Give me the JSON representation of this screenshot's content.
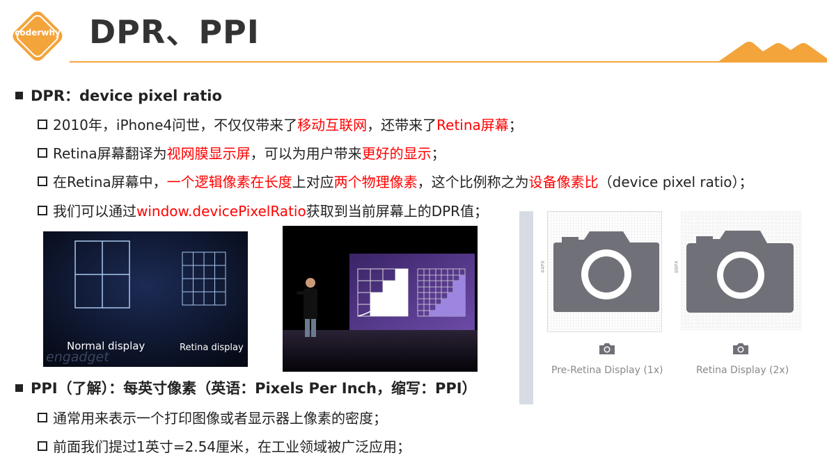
{
  "header": {
    "logo_text": "coderwhy",
    "title": "DPR、PPI"
  },
  "dpr": {
    "heading": "DPR：device pixel ratio",
    "items": [
      {
        "parts": [
          {
            "text": "2010年，iPhone4问世，不仅仅带来了",
            "red": false
          },
          {
            "text": "移动互联网",
            "red": true
          },
          {
            "text": "，还带来了",
            "red": false
          },
          {
            "text": "Retina屏幕",
            "red": true
          },
          {
            "text": "；",
            "red": false
          }
        ]
      },
      {
        "parts": [
          {
            "text": "Retina屏幕翻译为",
            "red": false
          },
          {
            "text": "视网膜显示屏",
            "red": true
          },
          {
            "text": "，可以为用户带来",
            "red": false
          },
          {
            "text": "更好的显示",
            "red": true
          },
          {
            "text": "；",
            "red": false
          }
        ]
      },
      {
        "parts": [
          {
            "text": "在Retina屏幕中，",
            "red": false
          },
          {
            "text": "一个逻辑像素在长度",
            "red": true
          },
          {
            "text": "上对应",
            "red": false
          },
          {
            "text": "两个物理像素",
            "red": true
          },
          {
            "text": "，这个比例称之为",
            "red": false
          },
          {
            "text": "设备像素比",
            "red": true
          },
          {
            "text": "（device pixel ratio）；",
            "red": false
          }
        ]
      },
      {
        "parts": [
          {
            "text": "我们可以通过",
            "red": false
          },
          {
            "text": "window.devicePixelRatio",
            "red": true
          },
          {
            "text": "获取到当前屏幕上的DPR值；",
            "red": false
          }
        ]
      }
    ]
  },
  "images": {
    "normal_caption": "Normal display",
    "retina_caption": "Retina display",
    "watermark": "engadget",
    "pre_retina_label": "Pre-Retina Display (1x)",
    "retina_label": "Retina Display (2x)",
    "size_1x": "44PX",
    "size_2x": "88PX"
  },
  "ppi": {
    "heading": "PPI（了解）：每英寸像素（英语：Pixels Per Inch，缩写：PPI）",
    "items": [
      {
        "parts": [
          {
            "text": "通常用来表示一个打印图像或者显示器上像素的密度；",
            "red": false
          }
        ]
      },
      {
        "parts": [
          {
            "text": "前面我们提过1英寸=2.54厘米，在工业领域被广泛应用；",
            "red": false
          }
        ]
      }
    ]
  },
  "colors": {
    "accent": "#f3a43b",
    "highlight": "#ff0000"
  }
}
